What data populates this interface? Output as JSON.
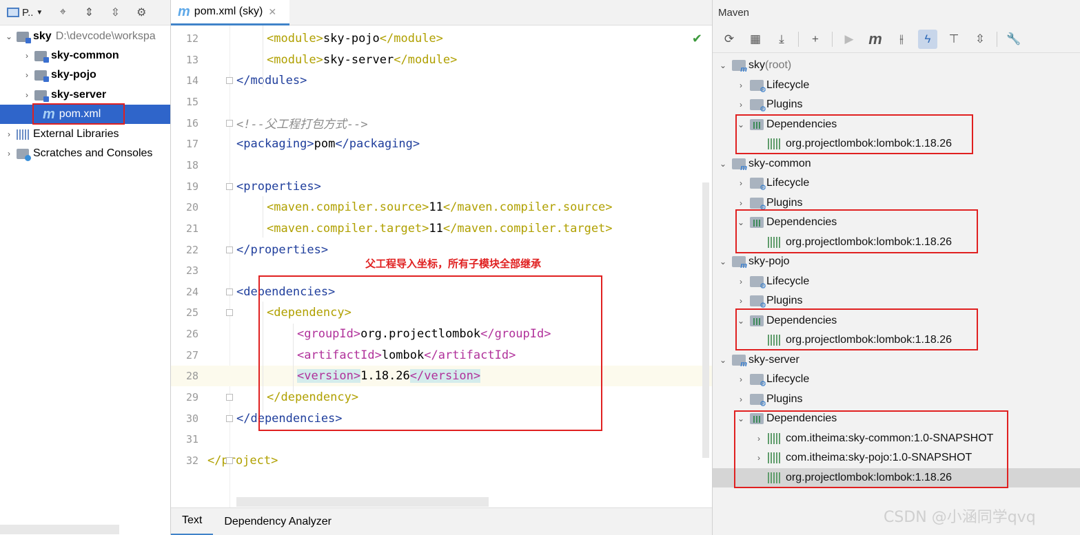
{
  "project": {
    "title": "P..",
    "items": [
      {
        "label": "sky",
        "path": "D:\\devcode\\workspa"
      },
      {
        "label": "sky-common"
      },
      {
        "label": "sky-pojo"
      },
      {
        "label": "sky-server"
      },
      {
        "label": "pom.xml"
      },
      {
        "label": "External Libraries"
      },
      {
        "label": "Scratches and Consoles"
      }
    ]
  },
  "editor": {
    "tab_label": "pom.xml (sky)",
    "annotation": "父工程导入坐标，所有子模块全部继承",
    "bottom_tabs": [
      "Text",
      "Dependency Analyzer"
    ],
    "lines": [
      {
        "n": "12",
        "parts": [
          [
            "    ",
            ""
          ],
          [
            "<module>",
            "gold"
          ],
          [
            "sky-pojo",
            "text"
          ],
          [
            "</module>",
            "gold"
          ]
        ]
      },
      {
        "n": "13",
        "parts": [
          [
            "    ",
            ""
          ],
          [
            "<module>",
            "gold"
          ],
          [
            "sky-server",
            "text"
          ],
          [
            "</module>",
            "gold"
          ]
        ]
      },
      {
        "n": "14",
        "parts": [
          [
            "",
            ""
          ],
          [
            "</modules>",
            "blue"
          ]
        ]
      },
      {
        "n": "15",
        "parts": []
      },
      {
        "n": "16",
        "parts": [
          [
            "",
            ""
          ],
          [
            "<!--父工程打包方式-->",
            "comment"
          ]
        ]
      },
      {
        "n": "17",
        "parts": [
          [
            "",
            ""
          ],
          [
            "<packaging>",
            "blue"
          ],
          [
            "pom",
            "text"
          ],
          [
            "</packaging>",
            "blue"
          ]
        ]
      },
      {
        "n": "18",
        "parts": []
      },
      {
        "n": "19",
        "parts": [
          [
            "",
            ""
          ],
          [
            "<properties>",
            "blue"
          ]
        ]
      },
      {
        "n": "20",
        "parts": [
          [
            "    ",
            ""
          ],
          [
            "<maven.compiler.source>",
            "gold"
          ],
          [
            "11",
            "text"
          ],
          [
            "</maven.compiler.source>",
            "gold"
          ]
        ]
      },
      {
        "n": "21",
        "parts": [
          [
            "    ",
            ""
          ],
          [
            "<maven.compiler.target>",
            "gold"
          ],
          [
            "11",
            "text"
          ],
          [
            "</maven.compiler.target>",
            "gold"
          ]
        ]
      },
      {
        "n": "22",
        "parts": [
          [
            "",
            ""
          ],
          [
            "</properties>",
            "blue"
          ]
        ]
      },
      {
        "n": "23",
        "parts": []
      },
      {
        "n": "24",
        "parts": [
          [
            "",
            ""
          ],
          [
            "<dependencies>",
            "blue"
          ]
        ]
      },
      {
        "n": "25",
        "parts": [
          [
            "    ",
            ""
          ],
          [
            "<dependency>",
            "gold"
          ]
        ]
      },
      {
        "n": "26",
        "parts": [
          [
            "        ",
            ""
          ],
          [
            "<groupId>",
            "mag"
          ],
          [
            "org.projectlombok",
            "text"
          ],
          [
            "</groupId>",
            "mag"
          ]
        ]
      },
      {
        "n": "27",
        "parts": [
          [
            "        ",
            ""
          ],
          [
            "<artifactId>",
            "mag"
          ],
          [
            "lombok",
            "text"
          ],
          [
            "</artifactId>",
            "mag"
          ]
        ]
      },
      {
        "n": "28",
        "parts": [
          [
            "        ",
            ""
          ],
          [
            "<version>",
            "maghl"
          ],
          [
            "1.18.26",
            "text"
          ],
          [
            "</version>",
            "maghl"
          ]
        ]
      },
      {
        "n": "29",
        "parts": [
          [
            "    ",
            ""
          ],
          [
            "</dependency>",
            "gold"
          ]
        ]
      },
      {
        "n": "30",
        "parts": [
          [
            "",
            ""
          ],
          [
            "</dependencies>",
            "blue"
          ]
        ]
      },
      {
        "n": "31",
        "parts": []
      },
      {
        "n": "32",
        "parts": [
          [
            "",
            ""
          ],
          [
            "</project>",
            "gold"
          ]
        ]
      }
    ]
  },
  "maven": {
    "title": "Maven",
    "rows": [
      {
        "indent": 0,
        "chev": "v",
        "icon": "module",
        "label": "sky",
        "suffix": " (root)"
      },
      {
        "indent": 1,
        "chev": ">",
        "icon": "gear",
        "label": "Lifecycle"
      },
      {
        "indent": 1,
        "chev": ">",
        "icon": "gear",
        "label": "Plugins"
      },
      {
        "indent": 1,
        "chev": "v",
        "icon": "depfolder",
        "label": "Dependencies"
      },
      {
        "indent": 2,
        "chev": "",
        "icon": "dep",
        "label": "org.projectlombok:lombok:1.18.26"
      },
      {
        "indent": 0,
        "chev": "v",
        "icon": "module",
        "label": "sky-common"
      },
      {
        "indent": 1,
        "chev": ">",
        "icon": "gear",
        "label": "Lifecycle"
      },
      {
        "indent": 1,
        "chev": ">",
        "icon": "gear",
        "label": "Plugins"
      },
      {
        "indent": 1,
        "chev": "v",
        "icon": "depfolder",
        "label": "Dependencies"
      },
      {
        "indent": 2,
        "chev": "",
        "icon": "dep",
        "label": "org.projectlombok:lombok:1.18.26"
      },
      {
        "indent": 0,
        "chev": "v",
        "icon": "module",
        "label": "sky-pojo"
      },
      {
        "indent": 1,
        "chev": ">",
        "icon": "gear",
        "label": "Lifecycle"
      },
      {
        "indent": 1,
        "chev": ">",
        "icon": "gear",
        "label": "Plugins"
      },
      {
        "indent": 1,
        "chev": "v",
        "icon": "depfolder",
        "label": "Dependencies"
      },
      {
        "indent": 2,
        "chev": "",
        "icon": "dep",
        "label": "org.projectlombok:lombok:1.18.26"
      },
      {
        "indent": 0,
        "chev": "v",
        "icon": "module",
        "label": "sky-server"
      },
      {
        "indent": 1,
        "chev": ">",
        "icon": "gear",
        "label": "Lifecycle"
      },
      {
        "indent": 1,
        "chev": ">",
        "icon": "gear",
        "label": "Plugins"
      },
      {
        "indent": 1,
        "chev": "v",
        "icon": "depfolder",
        "label": "Dependencies"
      },
      {
        "indent": 2,
        "chev": ">",
        "icon": "dep",
        "label": "com.itheima:sky-common:1.0-SNAPSHOT"
      },
      {
        "indent": 2,
        "chev": ">",
        "icon": "dep",
        "label": "com.itheima:sky-pojo:1.0-SNAPSHOT"
      },
      {
        "indent": 2,
        "chev": "",
        "icon": "dep",
        "label": "org.projectlombok:lombok:1.18.26",
        "selected": true
      }
    ]
  },
  "watermark": "CSDN @小涵同学qvq"
}
